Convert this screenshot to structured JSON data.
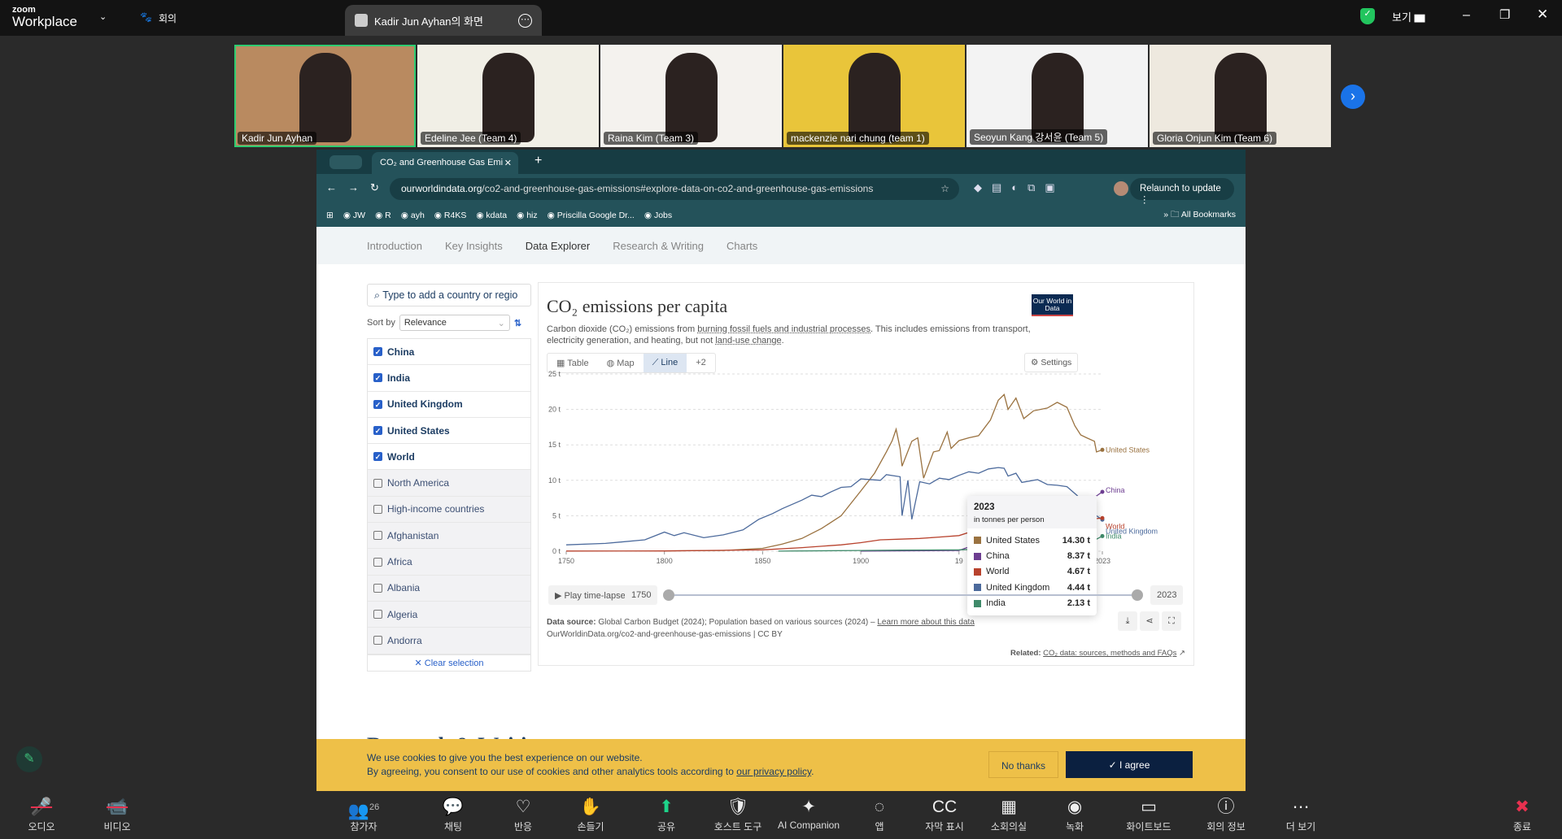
{
  "zoom": {
    "logo_small": "zoom",
    "logo_big": "Workplace",
    "meeting_label": "회의",
    "share_title": "Kadir Jun Ayhan의 화면",
    "view_label": "보기"
  },
  "participants": [
    {
      "name": "Kadir Jun Ayhan",
      "bg": "#b98a60"
    },
    {
      "name": "Edeline Jee (Team 4)",
      "bg": "#f1efe6"
    },
    {
      "name": "Raina Kim (Team 3)",
      "bg": "#f4f2ee"
    },
    {
      "name": "mackenzie nari chung (team 1)",
      "bg": "#e9c53a"
    },
    {
      "name": "Seoyun Kang 강서윤 (Team 5)",
      "bg": "#f3f3f3"
    },
    {
      "name": "Gloria Onjun Kim (Team 6)",
      "bg": "#eee9df"
    }
  ],
  "browser": {
    "tab_title": "CO₂ and Greenhouse Gas Emi",
    "url_domain": "ourworldindata.org",
    "url_path": "/co2-and-greenhouse-gas-emissions#explore-data-on-co2-and-greenhouse-gas-emissions",
    "relaunch": "Relaunch to update",
    "bookmarks": [
      "JW",
      "R",
      "ayh",
      "R4KS",
      "kdata",
      "hiz",
      "Priscilla Google Dr...",
      "Jobs"
    ],
    "all_bookmarks": "All Bookmarks"
  },
  "nav": [
    "Introduction",
    "Key Insights",
    "Data Explorer",
    "Research & Writing",
    "Charts"
  ],
  "sidebar": {
    "search_placeholder": "Type to add a country or regio",
    "sort_label": "Sort by",
    "sort_value": "Relevance",
    "clear": "✕ Clear selection",
    "items": [
      {
        "label": "China",
        "checked": true
      },
      {
        "label": "India",
        "checked": true
      },
      {
        "label": "United Kingdom",
        "checked": true
      },
      {
        "label": "United States",
        "checked": true
      },
      {
        "label": "World",
        "checked": true
      },
      {
        "label": "North America",
        "checked": false
      },
      {
        "label": "High-income countries",
        "checked": false
      },
      {
        "label": "Afghanistan",
        "checked": false
      },
      {
        "label": "Africa",
        "checked": false
      },
      {
        "label": "Albania",
        "checked": false
      },
      {
        "label": "Algeria",
        "checked": false
      },
      {
        "label": "Andorra",
        "checked": false
      }
    ]
  },
  "chart_tabs": {
    "table": "Table",
    "map": "Map",
    "line": "Line",
    "more": "+2",
    "settings": "Settings"
  },
  "logo": "Our World in Data",
  "chart_data": {
    "type": "line",
    "title": "CO₂ emissions per capita",
    "subtitle_a": "Carbon dioxide (CO₂) emissions from ",
    "subtitle_link1": "burning fossil fuels and industrial processes",
    "subtitle_b": ". This includes emissions from transport, electricity generation, and heating, but not ",
    "subtitle_link2": "land-use change",
    "subtitle_c": ".",
    "ylim": [
      0,
      25
    ],
    "xlim": [
      1750,
      2023
    ],
    "yticks": [
      {
        "v": 0,
        "label": "0 t"
      },
      {
        "v": 5,
        "label": "5 t"
      },
      {
        "v": 10,
        "label": "10 t"
      },
      {
        "v": 15,
        "label": "15 t"
      },
      {
        "v": 20,
        "label": "20 t"
      },
      {
        "v": 25,
        "label": "25 t"
      }
    ],
    "xticks": [
      {
        "v": 1750,
        "label": "1750"
      },
      {
        "v": 1800,
        "label": "1800"
      },
      {
        "v": 1850,
        "label": "1850"
      },
      {
        "v": 1900,
        "label": "1900"
      },
      {
        "v": 1950,
        "label": "19"
      },
      {
        "v": 2023,
        "label": "2023"
      }
    ],
    "series": [
      {
        "name": "United States",
        "color": "#9a7240",
        "points": [
          [
            1800,
            0.05
          ],
          [
            1830,
            0.1
          ],
          [
            1850,
            0.4
          ],
          [
            1860,
            1
          ],
          [
            1870,
            1.8
          ],
          [
            1880,
            3.2
          ],
          [
            1890,
            5
          ],
          [
            1900,
            8.5
          ],
          [
            1907,
            11
          ],
          [
            1913,
            14
          ],
          [
            1916,
            15.6
          ],
          [
            1918,
            17.2
          ],
          [
            1920,
            14.5
          ],
          [
            1921,
            12
          ],
          [
            1926,
            15.5
          ],
          [
            1929,
            16
          ],
          [
            1932,
            10.3
          ],
          [
            1937,
            14
          ],
          [
            1940,
            14.2
          ],
          [
            1944,
            16.8
          ],
          [
            1946,
            14.5
          ],
          [
            1950,
            15.6
          ],
          [
            1955,
            16
          ],
          [
            1960,
            16.3
          ],
          [
            1966,
            18.5
          ],
          [
            1970,
            21.3
          ],
          [
            1973,
            22.1
          ],
          [
            1975,
            20
          ],
          [
            1979,
            21.6
          ],
          [
            1983,
            18.7
          ],
          [
            1988,
            19.8
          ],
          [
            1995,
            20.2
          ],
          [
            2000,
            21
          ],
          [
            2005,
            20.3
          ],
          [
            2009,
            17.7
          ],
          [
            2012,
            16.4
          ],
          [
            2015,
            16
          ],
          [
            2019,
            15.5
          ],
          [
            2020,
            14
          ],
          [
            2023,
            14.3
          ]
        ]
      },
      {
        "name": "United Kingdom",
        "color": "#4c6a9c",
        "points": [
          [
            1750,
            0.9
          ],
          [
            1770,
            1.1
          ],
          [
            1790,
            1.6
          ],
          [
            1800,
            2.7
          ],
          [
            1805,
            2.2
          ],
          [
            1810,
            2.6
          ],
          [
            1820,
            1.9
          ],
          [
            1830,
            2.3
          ],
          [
            1840,
            3
          ],
          [
            1848,
            4.5
          ],
          [
            1855,
            5.3
          ],
          [
            1860,
            6
          ],
          [
            1870,
            7.2
          ],
          [
            1875,
            7.9
          ],
          [
            1880,
            7.7
          ],
          [
            1885,
            8.4
          ],
          [
            1890,
            9
          ],
          [
            1895,
            9.1
          ],
          [
            1900,
            10.2
          ],
          [
            1910,
            10
          ],
          [
            1913,
            10.8
          ],
          [
            1920,
            10.5
          ],
          [
            1921,
            5
          ],
          [
            1924,
            10
          ],
          [
            1926,
            4.5
          ],
          [
            1930,
            9.8
          ],
          [
            1935,
            9.5
          ],
          [
            1940,
            10.3
          ],
          [
            1945,
            10.1
          ],
          [
            1950,
            10.7
          ],
          [
            1955,
            11.2
          ],
          [
            1960,
            11
          ],
          [
            1965,
            11.6
          ],
          [
            1970,
            11.8
          ],
          [
            1973,
            11.7
          ],
          [
            1975,
            10.6
          ],
          [
            1979,
            11
          ],
          [
            1982,
            9.7
          ],
          [
            1990,
            10.1
          ],
          [
            1995,
            9.4
          ],
          [
            2000,
            9.3
          ],
          [
            2005,
            9.1
          ],
          [
            2010,
            7.9
          ],
          [
            2015,
            6.4
          ],
          [
            2020,
            5
          ],
          [
            2023,
            4.44
          ]
        ]
      },
      {
        "name": "World",
        "color": "#b8422d",
        "points": [
          [
            1750,
            0.02
          ],
          [
            1800,
            0.04
          ],
          [
            1850,
            0.2
          ],
          [
            1870,
            0.5
          ],
          [
            1890,
            0.9
          ],
          [
            1900,
            1.2
          ],
          [
            1910,
            1.6
          ],
          [
            1920,
            1.7
          ],
          [
            1930,
            1.8
          ],
          [
            1940,
            2
          ],
          [
            1950,
            2.2
          ],
          [
            1960,
            3.1
          ],
          [
            1970,
            3.9
          ],
          [
            1979,
            4.5
          ],
          [
            1983,
            4.1
          ],
          [
            1990,
            4.3
          ],
          [
            2000,
            4.1
          ],
          [
            2005,
            4.5
          ],
          [
            2012,
            4.9
          ],
          [
            2020,
            4.6
          ],
          [
            2023,
            4.67
          ]
        ]
      },
      {
        "name": "China",
        "color": "#6d3e91",
        "points": [
          [
            1900,
            0.01
          ],
          [
            1950,
            0.1
          ],
          [
            1958,
            0.9
          ],
          [
            1961,
            1.1
          ],
          [
            1965,
            0.7
          ],
          [
            1970,
            0.9
          ],
          [
            1980,
            1.5
          ],
          [
            1990,
            1.9
          ],
          [
            2000,
            2.7
          ],
          [
            2005,
            4.4
          ],
          [
            2010,
            6.5
          ],
          [
            2013,
            7.5
          ],
          [
            2017,
            7.3
          ],
          [
            2020,
            7.8
          ],
          [
            2023,
            8.37
          ]
        ]
      },
      {
        "name": "India",
        "color": "#3f8a6a",
        "points": [
          [
            1858,
            0.01
          ],
          [
            1900,
            0.1
          ],
          [
            1920,
            0.15
          ],
          [
            1950,
            0.2
          ],
          [
            1970,
            0.35
          ],
          [
            1980,
            0.45
          ],
          [
            1990,
            0.7
          ],
          [
            2000,
            0.95
          ],
          [
            2010,
            1.4
          ],
          [
            2019,
            1.8
          ],
          [
            2020,
            1.7
          ],
          [
            2023,
            2.13
          ]
        ]
      }
    ]
  },
  "tooltip": {
    "year": "2023",
    "unit": "in tonnes per person",
    "rows": [
      {
        "name": "United States",
        "value": "14.30 t",
        "color": "#9a7240"
      },
      {
        "name": "China",
        "value": "8.37 t",
        "color": "#6d3e91"
      },
      {
        "name": "World",
        "value": "4.67 t",
        "color": "#b8422d"
      },
      {
        "name": "United Kingdom",
        "value": "4.44 t",
        "color": "#4c6a9c"
      },
      {
        "name": "India",
        "value": "2.13 t",
        "color": "#3f8a6a"
      }
    ]
  },
  "timeline": {
    "play": "Play time-lapse",
    "start": "1750",
    "end": "2023"
  },
  "source": {
    "label": "Data source:",
    "text": " Global Carbon Budget (2024); Population based on various sources (2024) – ",
    "link": "Learn more about this data",
    "line2": "OurWorldinData.org/co2-and-greenhouse-gas-emissions | CC BY",
    "related_label": "Related:",
    "related_link": "CO₂ data: sources, methods and FAQs"
  },
  "research_heading": "Research & Writing",
  "cookie": {
    "line1": "We use cookies to give you the best experience on our website.",
    "line2": "By agreeing, you consent to our use of cookies and other analytics tools according to ",
    "link": "our privacy policy",
    "no": "No thanks",
    "agree": "✓ I agree"
  },
  "toolbar": [
    {
      "label": "오디오",
      "icon": "🎤"
    },
    {
      "label": "비디오",
      "icon": "📹"
    },
    {
      "label": "참가자",
      "icon": "👥",
      "count": "26"
    },
    {
      "label": "채팅",
      "icon": "💬"
    },
    {
      "label": "반응",
      "icon": "♡"
    },
    {
      "label": "손들기",
      "icon": "✋"
    },
    {
      "label": "공유",
      "icon": "⬆"
    },
    {
      "label": "호스트 도구",
      "icon": "🛡"
    },
    {
      "label": "AI Companion",
      "icon": "✦"
    },
    {
      "label": "앱",
      "icon": "◌"
    },
    {
      "label": "자막 표시",
      "icon": "CC"
    },
    {
      "label": "소회의실",
      "icon": "▦"
    },
    {
      "label": "녹화",
      "icon": "◉"
    },
    {
      "label": "화이트보드",
      "icon": "▭"
    },
    {
      "label": "회의 정보",
      "icon": "ⓘ"
    },
    {
      "label": "더 보기",
      "icon": "⋯"
    },
    {
      "label": "종료",
      "icon": "✖"
    }
  ]
}
